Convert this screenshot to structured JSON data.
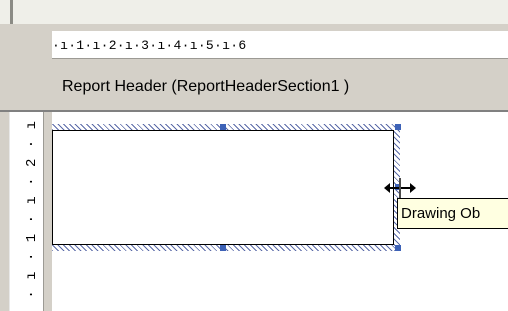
{
  "ruler": {
    "horizontal_text": "·ı·1·ı·2·ı·3·ı·4·ı·5·ı·6",
    "vertical_text": "· ı · 1 · ı · 2 · ı"
  },
  "section": {
    "title": "Report Header  (ReportHeaderSection1 )"
  },
  "tooltip": {
    "text": "Drawing Ob"
  },
  "cursor": {
    "icon": "resize-horizontal-cursor-icon"
  },
  "colors": {
    "chrome": "#d4d0c8",
    "selection_handle": "#3d62b7",
    "tooltip_bg": "#ffffe1"
  }
}
